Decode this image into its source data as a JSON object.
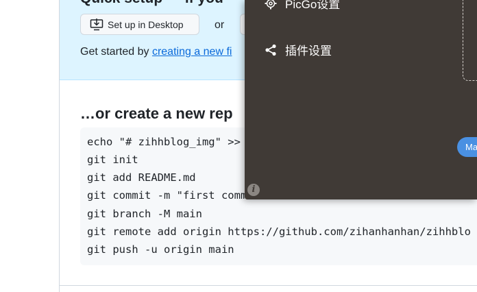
{
  "github": {
    "quick_setup": {
      "title": "Quick setup — if you",
      "desktop_button_label": "Set up in Desktop",
      "or_label": "or",
      "get_started_prefix": "Get started by ",
      "get_started_link": "creating a new fi"
    },
    "new_repo": {
      "heading": "…or create a new rep",
      "code_lines": [
        "echo \"# zihhblog_img\" >>",
        "git init",
        "git add README.md",
        "git commit -m \"first commit\"",
        "git branch -M main",
        "git remote add origin https://github.com/zihanhanhan/zihhblo",
        "git push -u origin main"
      ]
    }
  },
  "picgo_menu": {
    "items": [
      {
        "label": "PicGo设置",
        "icon": "gear-icon"
      },
      {
        "label": "插件设置",
        "icon": "share-icon"
      }
    ],
    "pill_button_label": "Ma",
    "info_icon_glyph": "i"
  },
  "colors": {
    "setup_banner_bg": "#ddf4ff",
    "overlay_bg": "#403a36",
    "link": "#0969da",
    "pill_button": "#4a90e2"
  }
}
